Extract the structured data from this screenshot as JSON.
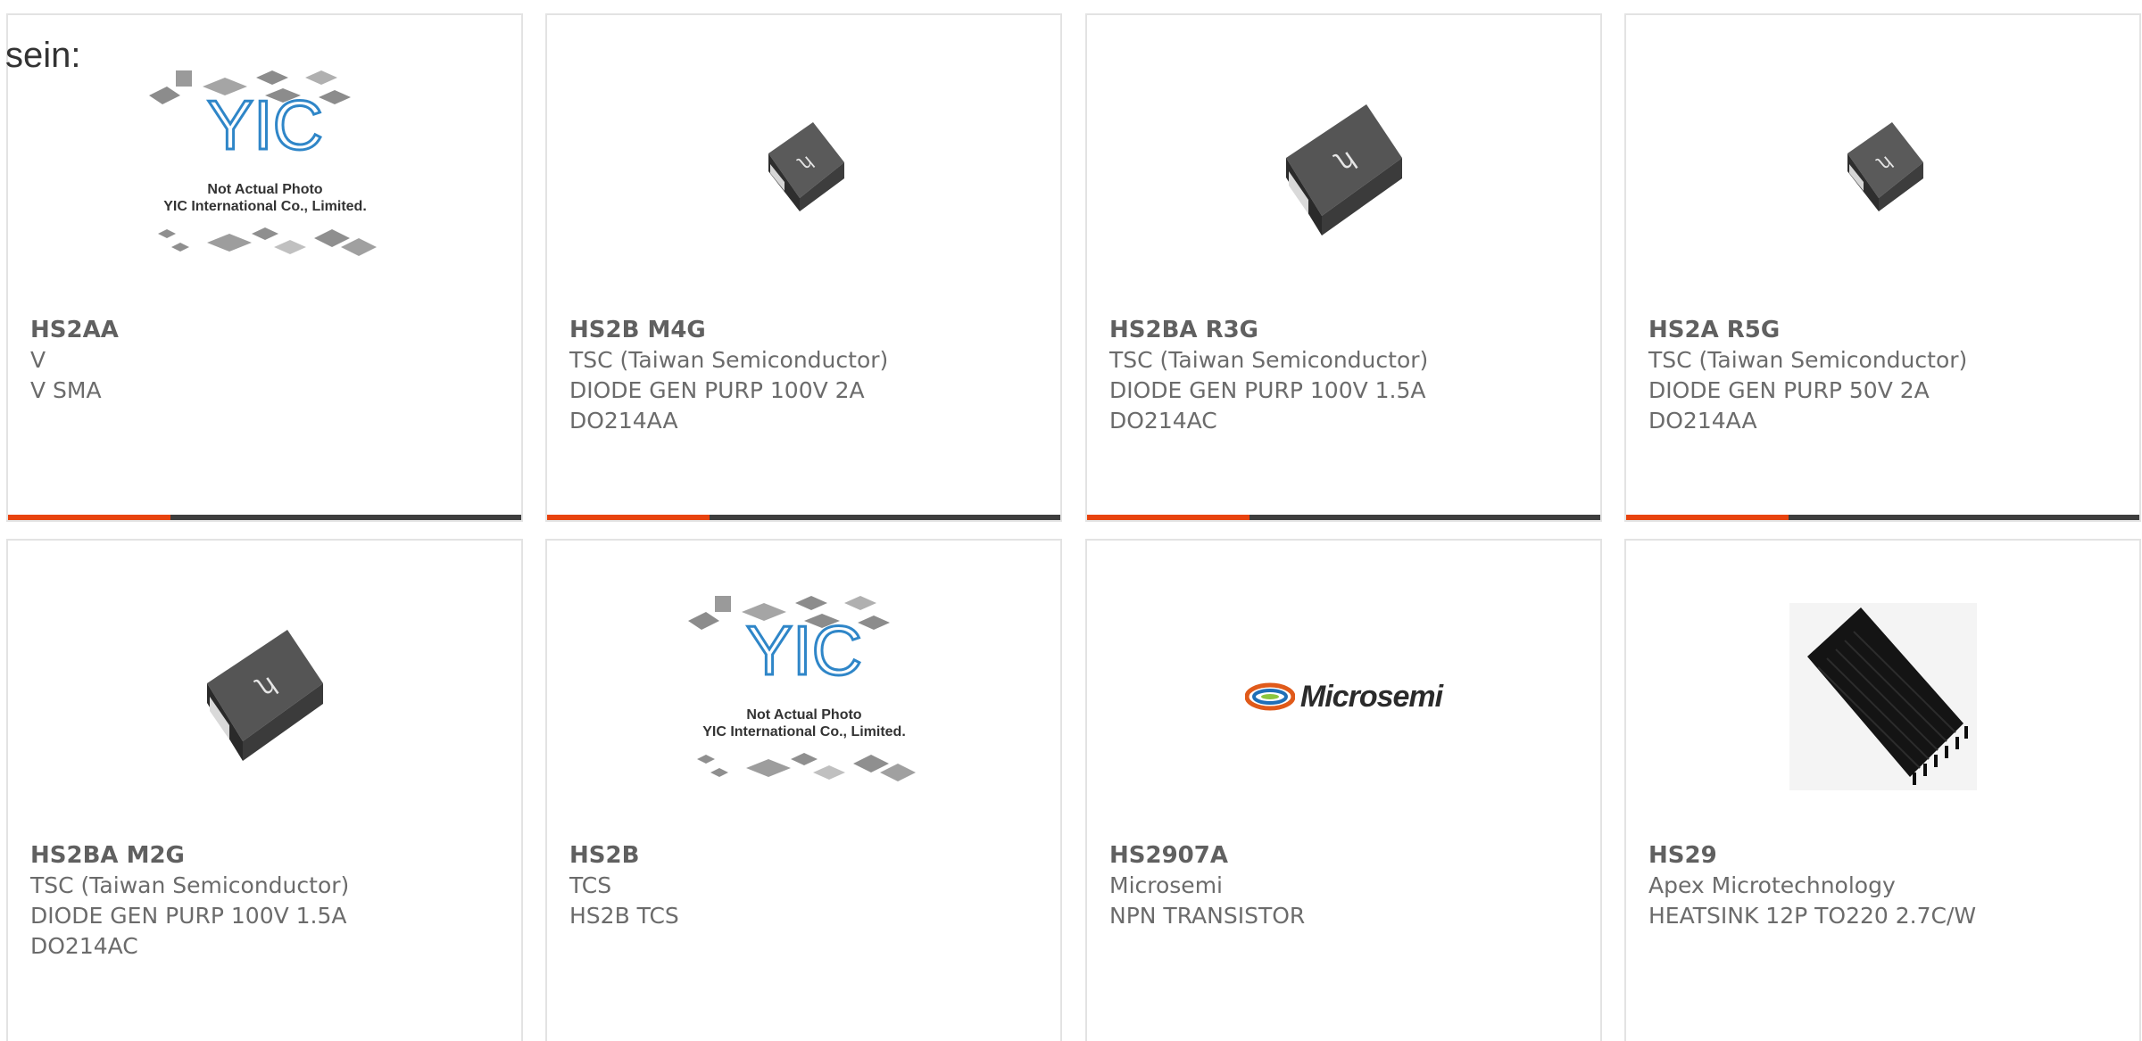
{
  "intro_text": "sein:",
  "colors": {
    "accent": "#e8430e",
    "accent_track": "#3d3d3d",
    "card_border": "#e3e3e3"
  },
  "placeholder": {
    "line1": "Not Actual Photo",
    "line2": "YIC International Co., Limited.",
    "logo": "YIC"
  },
  "products": [
    {
      "part": "HS2AA",
      "lines": [
        "V",
        "V SMA"
      ],
      "image": "yic-placeholder"
    },
    {
      "part": "HS2B M4G",
      "lines": [
        "TSC (Taiwan Semiconductor)",
        "DIODE GEN PURP 100V 2A",
        "DO214AA"
      ],
      "image": "diode-small"
    },
    {
      "part": "HS2BA R3G",
      "lines": [
        "TSC (Taiwan Semiconductor)",
        "DIODE GEN PURP 100V 1.5A",
        "DO214AC"
      ],
      "image": "diode-large"
    },
    {
      "part": "HS2A R5G",
      "lines": [
        "TSC (Taiwan Semiconductor)",
        "DIODE GEN PURP 50V 2A",
        "DO214AA"
      ],
      "image": "diode-small"
    },
    {
      "part": "HS2BA M2G",
      "lines": [
        "TSC (Taiwan Semiconductor)",
        "DIODE GEN PURP 100V 1.5A",
        "DO214AC"
      ],
      "image": "diode-large"
    },
    {
      "part": "HS2B",
      "lines": [
        "TCS",
        "HS2B TCS"
      ],
      "image": "yic-placeholder"
    },
    {
      "part": "HS2907A",
      "lines": [
        "Microsemi",
        "NPN TRANSISTOR"
      ],
      "image": "microsemi-logo",
      "logo_text": "Microsemi"
    },
    {
      "part": "HS29",
      "lines": [
        "Apex Microtechnology",
        "HEATSINK 12P TO220 2.7C/W"
      ],
      "image": "heatsink"
    }
  ]
}
